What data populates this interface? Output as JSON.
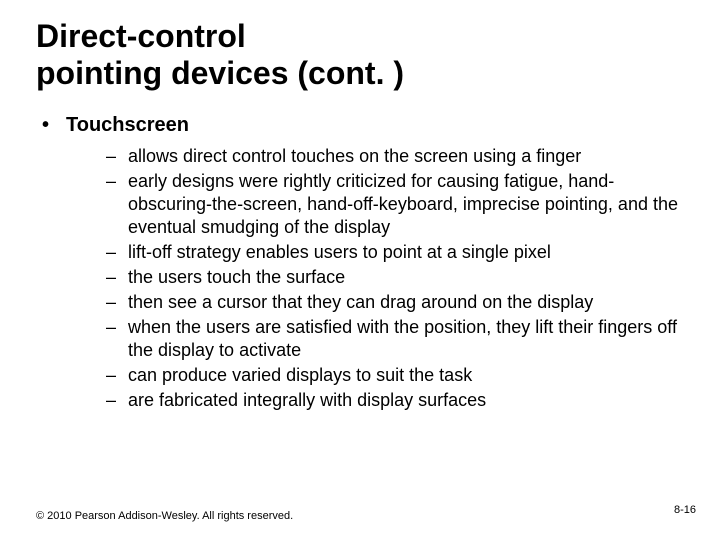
{
  "title_line1": "Direct-control",
  "title_line2": "pointing devices (cont. )",
  "bullets": {
    "main": "Touchscreen",
    "subs": [
      "allows direct control touches on the screen using a finger",
      "early designs were rightly criticized for causing fatigue, hand-obscuring-the-screen, hand-off-keyboard, imprecise pointing, and the eventual smudging of the display",
      "lift-off strategy enables users to point at a single pixel",
      "the users touch the surface",
      "then see a cursor that they can drag around on the display",
      "when the users are satisfied with the position, they lift their fingers off the display to activate",
      "can produce varied displays to suit the task",
      "are fabricated integrally with display surfaces"
    ]
  },
  "footer": "© 2010 Pearson Addison-Wesley. All rights reserved.",
  "page_number": "8-16"
}
